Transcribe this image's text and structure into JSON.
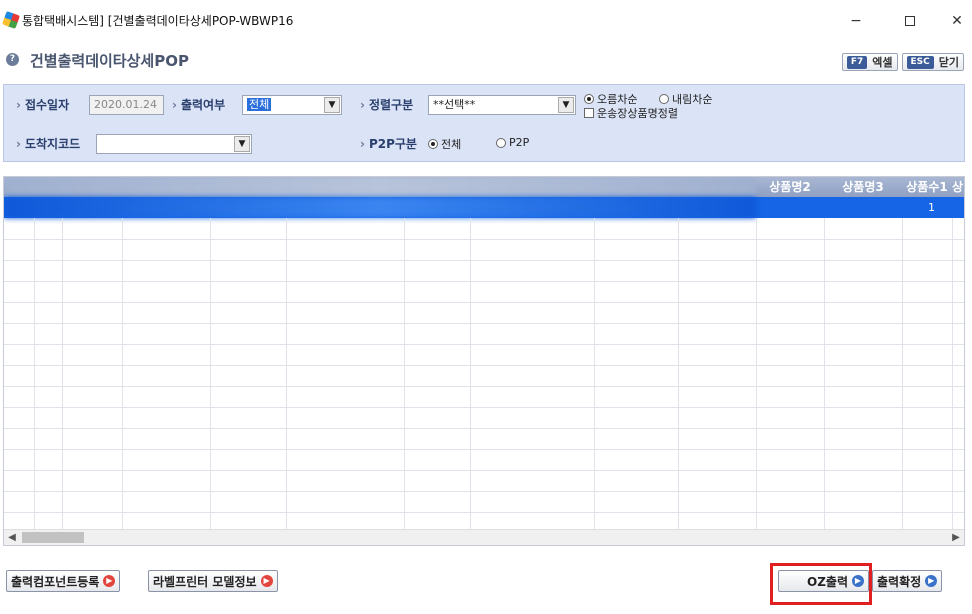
{
  "window": {
    "title": "통합택배시스템] [건별출력데이타상세POP-WBWP16",
    "min_glyph": "−",
    "close_glyph": "✕"
  },
  "header": {
    "title": "건별출력데이타상세POP",
    "excel_key": "F7",
    "excel_label": "엑셀",
    "close_key": "ESC",
    "close_label": "닫기"
  },
  "filter": {
    "receipt_date_label": "접수일자",
    "receipt_date_value": "2020.01.24",
    "print_yn_label": "출력여부",
    "print_yn_value": "전체",
    "sort_label": "정렬구분",
    "sort_value": "**선택**",
    "order_asc": "오름차순",
    "order_desc": "내림차순",
    "product_sort": "운송장상품명정렬",
    "dest_code_label": "도착지코드",
    "dest_code_value": "",
    "p2p_label": "P2P구분",
    "p2p_all": "전체",
    "p2p_p2p": "P2P"
  },
  "grid": {
    "columns": [
      "상품명2",
      "상품명3",
      "상품수1",
      "상"
    ],
    "selected_row_qty": "1"
  },
  "footer": {
    "btn_register": "출력컴포넌트등록",
    "btn_label_printer": "라벨프린터 모델정보",
    "btn_oz_print": "OZ출력",
    "btn_confirm": "출력확정"
  },
  "colors": {
    "accent": "#1565e6",
    "panel": "#dbe3f6",
    "highlight_box": "#e02020"
  }
}
